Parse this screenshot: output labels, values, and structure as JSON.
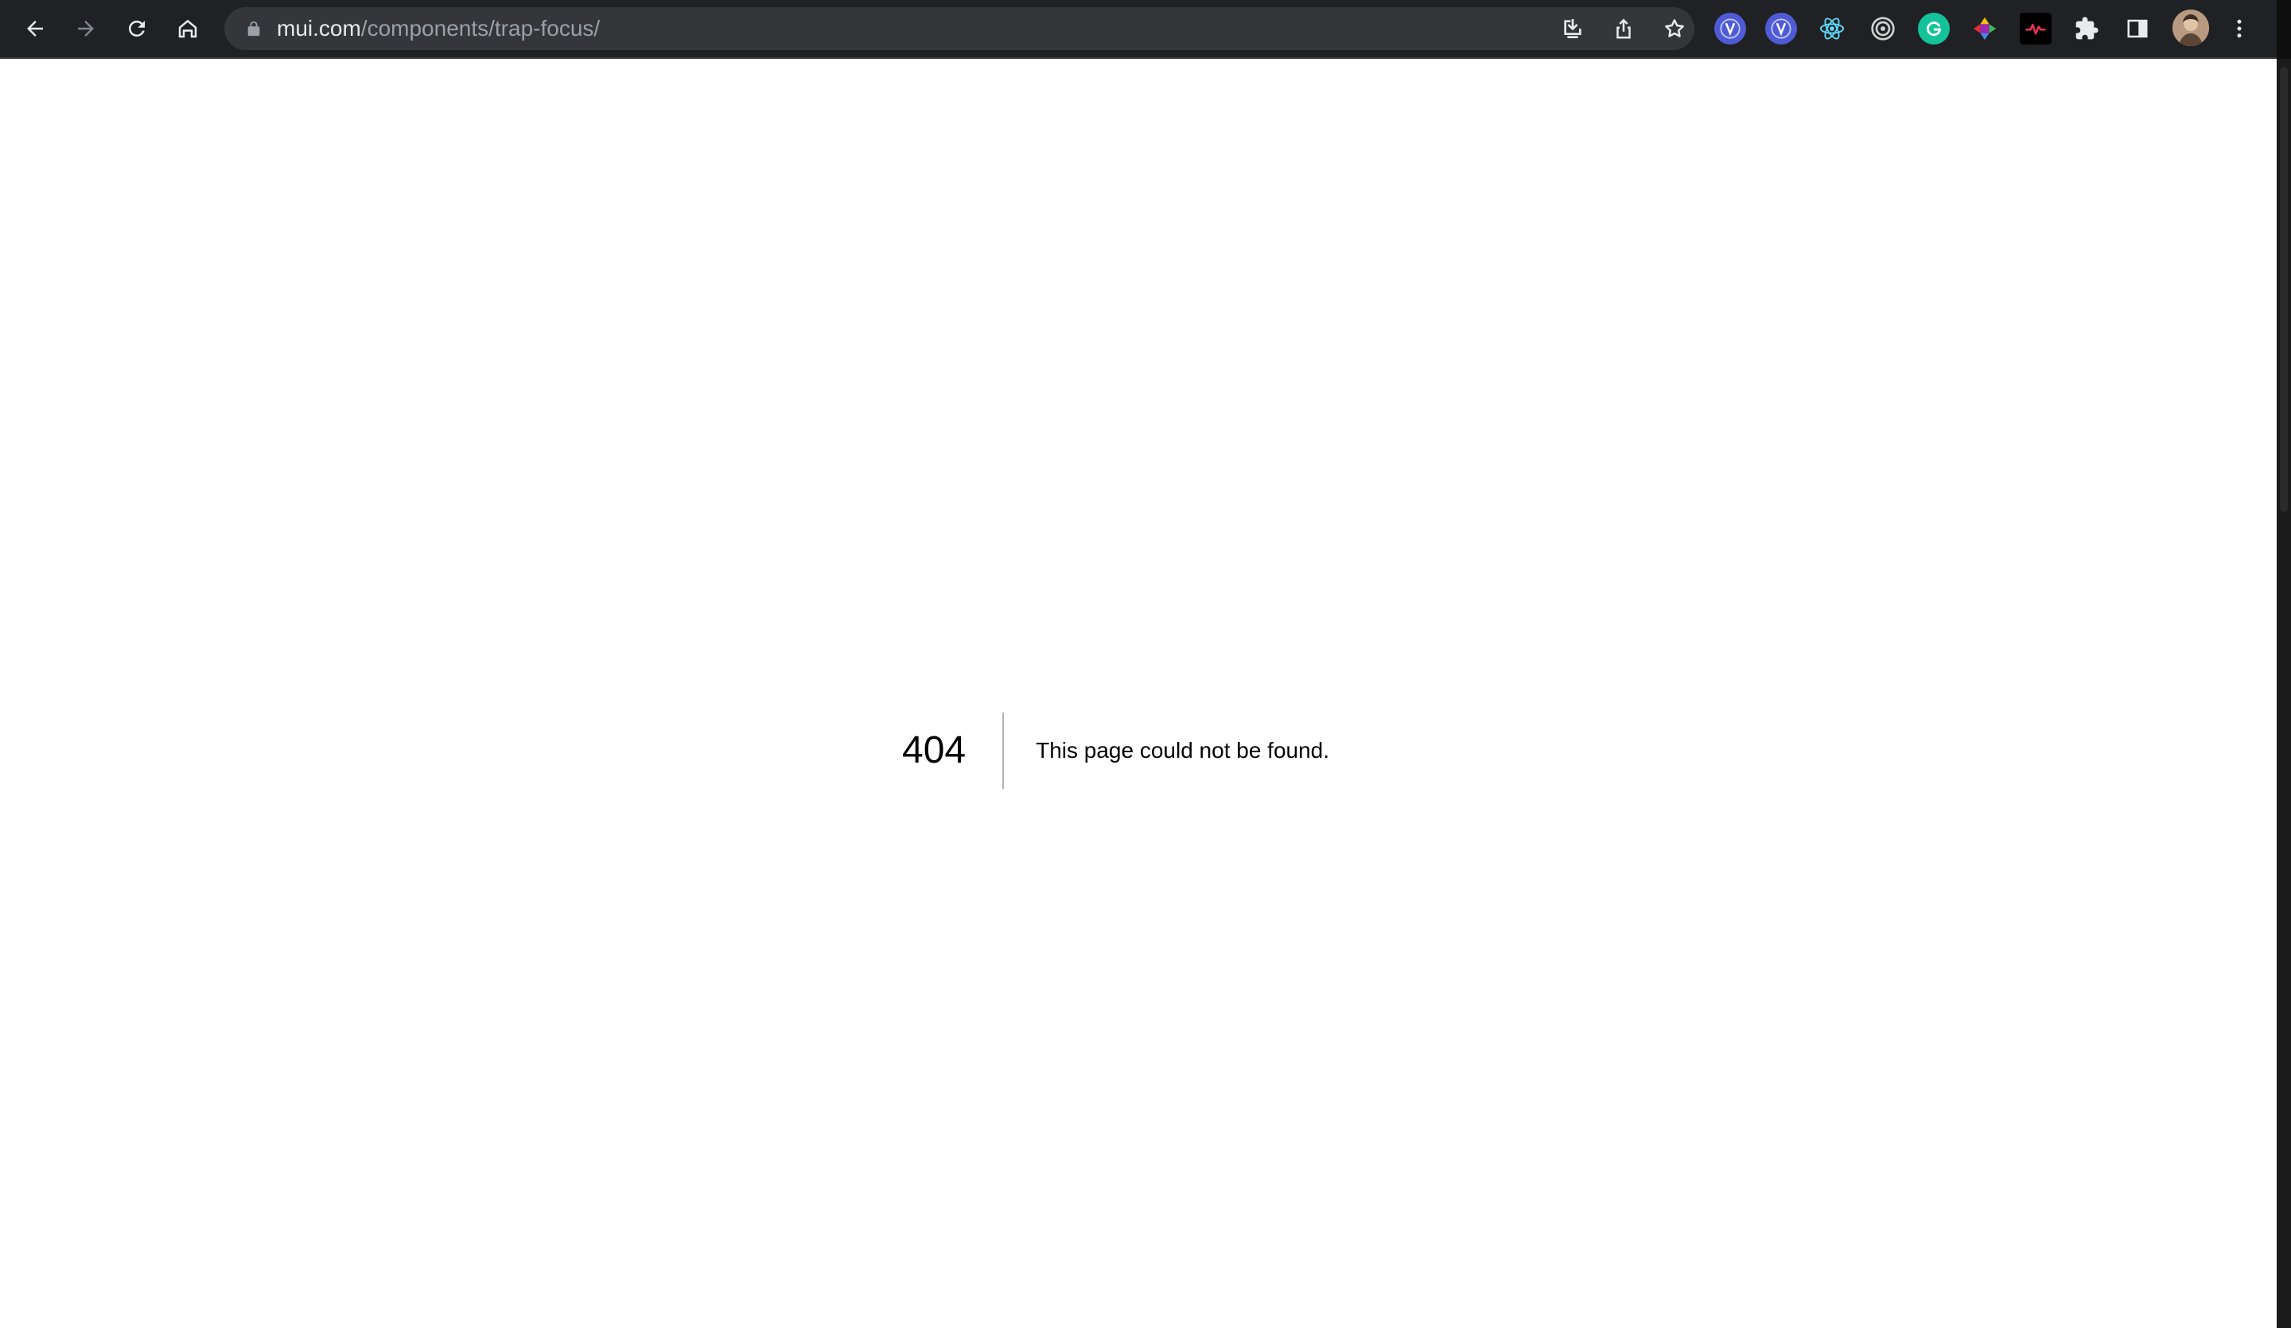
{
  "browser": {
    "url_host": "mui.com",
    "url_path": "/components/trap-focus/",
    "nav": {
      "back_icon": "arrow-left-icon",
      "forward_icon": "arrow-right-icon",
      "reload_icon": "reload-icon",
      "home_icon": "home-icon"
    },
    "omnibox_actions": [
      "install-icon",
      "share-icon",
      "star-icon"
    ],
    "extensions": [
      {
        "name": "extension-v-icon",
        "color": "#4f5bd5"
      },
      {
        "name": "extension-v2-icon",
        "color": "#4f5bd5"
      },
      {
        "name": "react-devtools-icon",
        "color": "#61dafb"
      },
      {
        "name": "target-icon",
        "color": "#d0d0d0"
      },
      {
        "name": "grammarly-icon",
        "color": "#15c39a"
      },
      {
        "name": "color-picker-icon",
        "color": "#e23c64"
      },
      {
        "name": "pulse-icon",
        "color": "#e8344e"
      },
      {
        "name": "puzzle-icon",
        "color": "#e8eaed"
      },
      {
        "name": "side-panel-icon",
        "color": "#e8eaed"
      }
    ]
  },
  "page": {
    "error_code": "404",
    "error_message": "This page could not be found."
  }
}
